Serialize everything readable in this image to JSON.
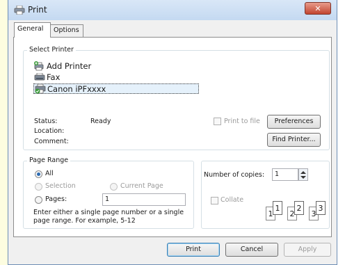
{
  "window": {
    "title": "Print",
    "close_glyph": "✕"
  },
  "tabs": [
    {
      "label": "General"
    },
    {
      "label": "Options"
    }
  ],
  "select_printer": {
    "legend": "Select Printer",
    "printers": [
      {
        "name": "Add Printer",
        "icon": "add-printer-icon"
      },
      {
        "name": "Fax",
        "icon": "fax-printer-icon"
      },
      {
        "name": "Canon iPFxxxx",
        "icon": "canon-printer-icon",
        "selected": true
      }
    ],
    "status_label": "Status:",
    "status_value": "Ready",
    "location_label": "Location:",
    "location_value": "",
    "comment_label": "Comment:",
    "comment_value": "",
    "print_to_file_label": "Print to file",
    "print_to_file_checked": false,
    "preferences_button": "Preferences",
    "find_printer_button": "Find Printer..."
  },
  "page_range": {
    "legend": "Page Range",
    "all_label": "All",
    "selection_label": "Selection",
    "current_page_label": "Current Page",
    "pages_label": "Pages:",
    "pages_value": "1",
    "selected_option": "All",
    "help_line1": "Enter either a single page number or a single",
    "help_line2": "page range.  For example, 5-12"
  },
  "copies": {
    "number_label": "Number of copies:",
    "number_value": "1",
    "collate_label": "Collate",
    "collate_checked": false,
    "collate_pages": [
      "1",
      "1",
      "2",
      "2",
      "3",
      "3"
    ]
  },
  "footer": {
    "print_button": "Print",
    "cancel_button": "Cancel",
    "apply_button": "Apply"
  },
  "colors": {
    "title_bar": "#c4d9f1",
    "close_button": "#c24530",
    "selection_highlight": "#e5f1fb",
    "radio_selected": "#2c6bb2"
  }
}
